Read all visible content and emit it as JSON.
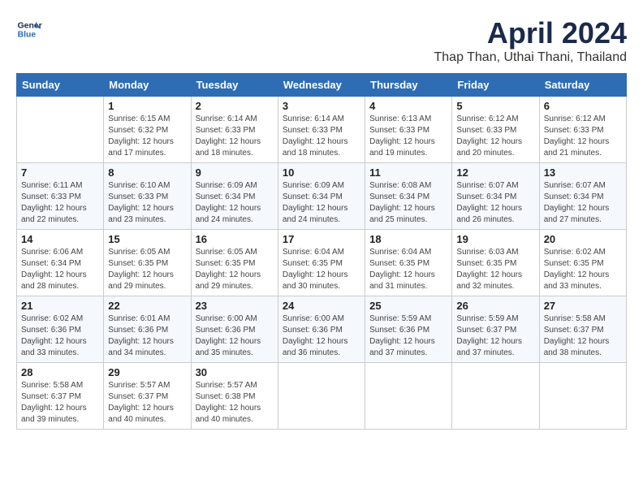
{
  "header": {
    "logo_line1": "General",
    "logo_line2": "Blue",
    "month": "April 2024",
    "location": "Thap Than, Uthai Thani, Thailand"
  },
  "days_of_week": [
    "Sunday",
    "Monday",
    "Tuesday",
    "Wednesday",
    "Thursday",
    "Friday",
    "Saturday"
  ],
  "weeks": [
    [
      {
        "day": "",
        "info": ""
      },
      {
        "day": "1",
        "info": "Sunrise: 6:15 AM\nSunset: 6:32 PM\nDaylight: 12 hours\nand 17 minutes."
      },
      {
        "day": "2",
        "info": "Sunrise: 6:14 AM\nSunset: 6:33 PM\nDaylight: 12 hours\nand 18 minutes."
      },
      {
        "day": "3",
        "info": "Sunrise: 6:14 AM\nSunset: 6:33 PM\nDaylight: 12 hours\nand 18 minutes."
      },
      {
        "day": "4",
        "info": "Sunrise: 6:13 AM\nSunset: 6:33 PM\nDaylight: 12 hours\nand 19 minutes."
      },
      {
        "day": "5",
        "info": "Sunrise: 6:12 AM\nSunset: 6:33 PM\nDaylight: 12 hours\nand 20 minutes."
      },
      {
        "day": "6",
        "info": "Sunrise: 6:12 AM\nSunset: 6:33 PM\nDaylight: 12 hours\nand 21 minutes."
      }
    ],
    [
      {
        "day": "7",
        "info": "Sunrise: 6:11 AM\nSunset: 6:33 PM\nDaylight: 12 hours\nand 22 minutes."
      },
      {
        "day": "8",
        "info": "Sunrise: 6:10 AM\nSunset: 6:33 PM\nDaylight: 12 hours\nand 23 minutes."
      },
      {
        "day": "9",
        "info": "Sunrise: 6:09 AM\nSunset: 6:34 PM\nDaylight: 12 hours\nand 24 minutes."
      },
      {
        "day": "10",
        "info": "Sunrise: 6:09 AM\nSunset: 6:34 PM\nDaylight: 12 hours\nand 24 minutes."
      },
      {
        "day": "11",
        "info": "Sunrise: 6:08 AM\nSunset: 6:34 PM\nDaylight: 12 hours\nand 25 minutes."
      },
      {
        "day": "12",
        "info": "Sunrise: 6:07 AM\nSunset: 6:34 PM\nDaylight: 12 hours\nand 26 minutes."
      },
      {
        "day": "13",
        "info": "Sunrise: 6:07 AM\nSunset: 6:34 PM\nDaylight: 12 hours\nand 27 minutes."
      }
    ],
    [
      {
        "day": "14",
        "info": "Sunrise: 6:06 AM\nSunset: 6:34 PM\nDaylight: 12 hours\nand 28 minutes."
      },
      {
        "day": "15",
        "info": "Sunrise: 6:05 AM\nSunset: 6:35 PM\nDaylight: 12 hours\nand 29 minutes."
      },
      {
        "day": "16",
        "info": "Sunrise: 6:05 AM\nSunset: 6:35 PM\nDaylight: 12 hours\nand 29 minutes."
      },
      {
        "day": "17",
        "info": "Sunrise: 6:04 AM\nSunset: 6:35 PM\nDaylight: 12 hours\nand 30 minutes."
      },
      {
        "day": "18",
        "info": "Sunrise: 6:04 AM\nSunset: 6:35 PM\nDaylight: 12 hours\nand 31 minutes."
      },
      {
        "day": "19",
        "info": "Sunrise: 6:03 AM\nSunset: 6:35 PM\nDaylight: 12 hours\nand 32 minutes."
      },
      {
        "day": "20",
        "info": "Sunrise: 6:02 AM\nSunset: 6:35 PM\nDaylight: 12 hours\nand 33 minutes."
      }
    ],
    [
      {
        "day": "21",
        "info": "Sunrise: 6:02 AM\nSunset: 6:36 PM\nDaylight: 12 hours\nand 33 minutes."
      },
      {
        "day": "22",
        "info": "Sunrise: 6:01 AM\nSunset: 6:36 PM\nDaylight: 12 hours\nand 34 minutes."
      },
      {
        "day": "23",
        "info": "Sunrise: 6:00 AM\nSunset: 6:36 PM\nDaylight: 12 hours\nand 35 minutes."
      },
      {
        "day": "24",
        "info": "Sunrise: 6:00 AM\nSunset: 6:36 PM\nDaylight: 12 hours\nand 36 minutes."
      },
      {
        "day": "25",
        "info": "Sunrise: 5:59 AM\nSunset: 6:36 PM\nDaylight: 12 hours\nand 37 minutes."
      },
      {
        "day": "26",
        "info": "Sunrise: 5:59 AM\nSunset: 6:37 PM\nDaylight: 12 hours\nand 37 minutes."
      },
      {
        "day": "27",
        "info": "Sunrise: 5:58 AM\nSunset: 6:37 PM\nDaylight: 12 hours\nand 38 minutes."
      }
    ],
    [
      {
        "day": "28",
        "info": "Sunrise: 5:58 AM\nSunset: 6:37 PM\nDaylight: 12 hours\nand 39 minutes."
      },
      {
        "day": "29",
        "info": "Sunrise: 5:57 AM\nSunset: 6:37 PM\nDaylight: 12 hours\nand 40 minutes."
      },
      {
        "day": "30",
        "info": "Sunrise: 5:57 AM\nSunset: 6:38 PM\nDaylight: 12 hours\nand 40 minutes."
      },
      {
        "day": "",
        "info": ""
      },
      {
        "day": "",
        "info": ""
      },
      {
        "day": "",
        "info": ""
      },
      {
        "day": "",
        "info": ""
      }
    ]
  ]
}
